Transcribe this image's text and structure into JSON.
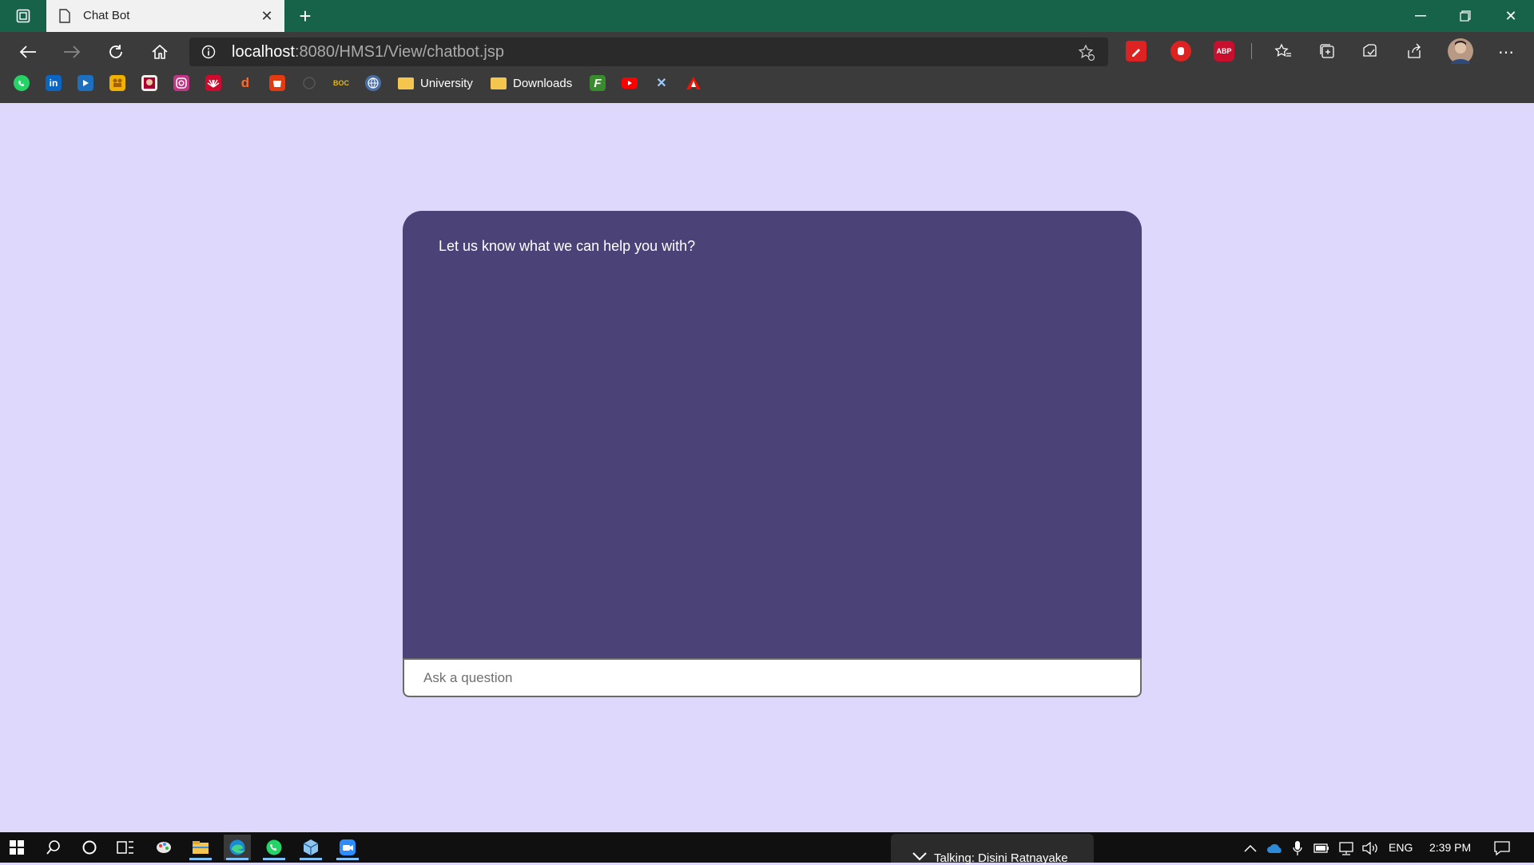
{
  "browser": {
    "tab_title": "Chat Bot",
    "url_host": "localhost",
    "url_rest": ":8080/HMS1/View/chatbot.jsp",
    "bookmarks": {
      "boc_label": "BOC",
      "university": "University",
      "downloads": "Downloads"
    },
    "extensions": {
      "abp_label": "ABP"
    }
  },
  "chat": {
    "greeting": "Let us know what we can help you with?",
    "input_placeholder": "Ask a question",
    "input_value": ""
  },
  "taskbar": {
    "zoom_popup": "Talking: Disini Ratnayake",
    "language": "ENG",
    "time": "2:39 PM"
  },
  "colors": {
    "titlebar": "#17634a",
    "toolbar": "#3b3b3b",
    "page_background": "#ded8fc",
    "chat_panel": "#4b4277"
  }
}
